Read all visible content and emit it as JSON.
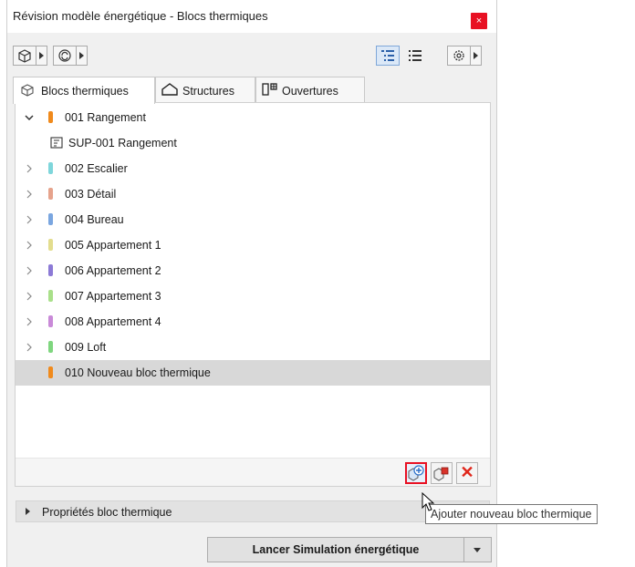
{
  "window": {
    "title": "Révision modèle énergétique - Blocs thermiques",
    "close_glyph": "×"
  },
  "toolbar": {
    "icons": [
      "building-icon",
      "refresh-icon",
      "tree-view-icon",
      "list-view-icon",
      "gear-icon"
    ]
  },
  "tabs": [
    {
      "label": "Blocs thermiques",
      "icon": "thermal-block-icon",
      "active": true
    },
    {
      "label": "Structures",
      "icon": "structure-icon",
      "active": false
    },
    {
      "label": "Ouvertures",
      "icon": "opening-icon",
      "active": false
    }
  ],
  "tree": {
    "items": [
      {
        "label": "001 Rangement",
        "color": "#f08a1c",
        "expanded": true
      },
      {
        "label": "SUP-001 Rangement",
        "icon": "zone-icon",
        "child": true
      },
      {
        "label": "002 Escalier",
        "color": "#7fd6db"
      },
      {
        "label": "003 Détail",
        "color": "#e6a38c"
      },
      {
        "label": "004 Bureau",
        "color": "#7aa6e0"
      },
      {
        "label": "005 Appartement 1",
        "color": "#e3dd8e"
      },
      {
        "label": "006 Appartement 2",
        "color": "#8c7ad6"
      },
      {
        "label": "007 Appartement 3",
        "color": "#a9e08a"
      },
      {
        "label": "008 Appartement 4",
        "color": "#c98ad8"
      },
      {
        "label": "009 Loft",
        "color": "#7fd67f"
      },
      {
        "label": "010 Nouveau bloc thermique",
        "color": "#f08a1c",
        "selected": true
      }
    ]
  },
  "bottom_actions": {
    "add_icon": "add-block-icon",
    "duplicate_icon": "duplicate-block-icon",
    "delete_glyph": "✕"
  },
  "properties": {
    "label": "Propriétés bloc thermique"
  },
  "tooltip": {
    "text": "Ajouter nouveau bloc thermique"
  },
  "run": {
    "label": "Lancer Simulation énergétique"
  }
}
